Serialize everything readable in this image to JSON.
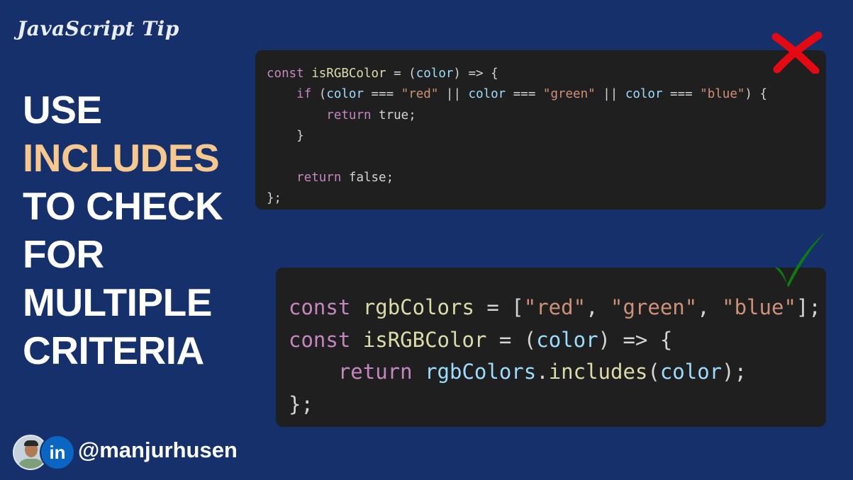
{
  "header": {
    "tip_label": "JavaScript Tip"
  },
  "headline": {
    "line1": "USE",
    "line2": "INCLUDES",
    "line3": "TO CHECK",
    "line4": "FOR",
    "line5": "MULTIPLE",
    "line6": "CRITERIA"
  },
  "colors": {
    "background": "#15306a",
    "highlight": "#f6c88f",
    "bad_mark": "#e50914",
    "good_mark": "#0f7a12"
  },
  "bad_example": {
    "mark_icon": "cross-icon",
    "lines": [
      [
        "const ",
        "isRGBColor",
        " = (",
        "color",
        ") => {"
      ],
      [
        "    ",
        "if",
        " (",
        "color",
        " === ",
        "\"red\"",
        " || ",
        "color",
        " === ",
        "\"green\"",
        " || ",
        "color",
        " === ",
        "\"blue\"",
        ") {"
      ],
      [
        "        ",
        "return",
        " true;"
      ],
      [
        "    }"
      ],
      [
        ""
      ],
      [
        "    ",
        "return",
        " false;"
      ],
      [
        "};"
      ]
    ]
  },
  "good_example": {
    "mark_icon": "checkmark-icon",
    "lines": [
      [
        "const",
        " ",
        "rgbColors",
        " = [",
        "\"red\"",
        ", ",
        "\"green\"",
        ", ",
        "\"blue\"",
        "];"
      ],
      [
        "const",
        " ",
        "isRGBColor",
        " = (",
        "color",
        ") => {"
      ],
      [
        "    ",
        "return",
        " ",
        "rgbColors",
        ".",
        "includes",
        "(",
        "color",
        ");"
      ],
      [
        "};"
      ]
    ]
  },
  "footer": {
    "avatar_icon": "avatar-icon",
    "social_icon": "linkedin-icon",
    "social_glyph": "in",
    "handle": "@manjurhusen"
  }
}
